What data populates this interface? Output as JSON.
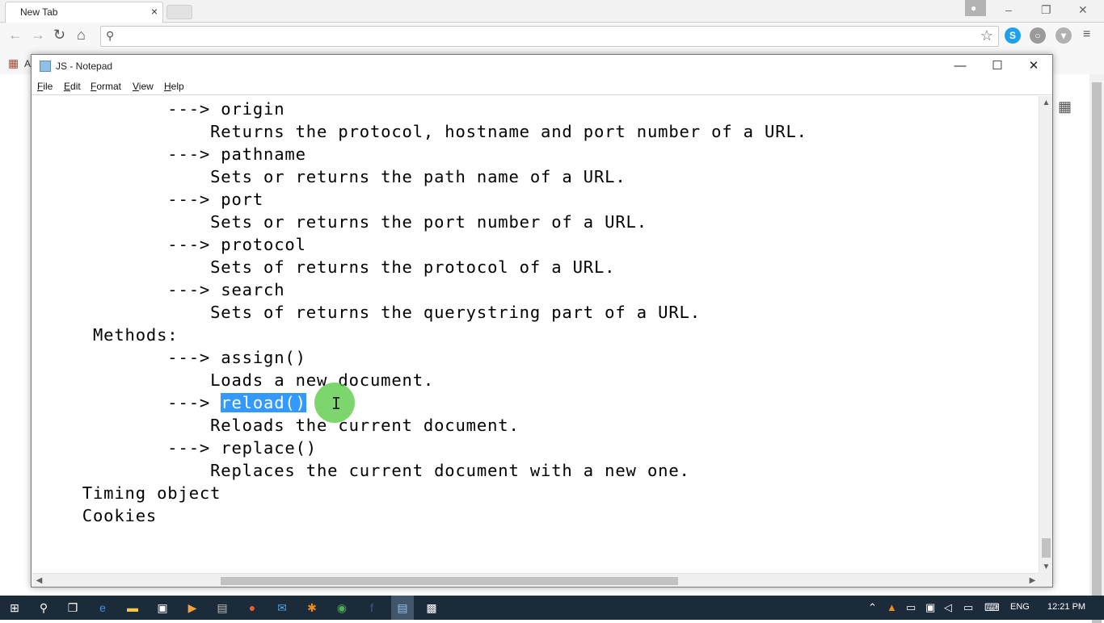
{
  "browser": {
    "tab_title": "New Tab",
    "tab_close": "×",
    "bookmarks_apps_label": "A",
    "window_controls": {
      "minimize": "–",
      "restore": "❐",
      "close": "✕"
    }
  },
  "notepad": {
    "title": "JS - Notepad",
    "menu": [
      {
        "label": "File",
        "accel": "F",
        "rest": "ile"
      },
      {
        "label": "Edit",
        "accel": "E",
        "rest": "dit"
      },
      {
        "label": "Format",
        "accel": "F",
        "rest": "ormat"
      },
      {
        "label": "View",
        "accel": "V",
        "rest": "iew"
      },
      {
        "label": "Help",
        "accel": "H",
        "rest": "elp"
      }
    ],
    "controls": {
      "minimize": "—",
      "maximize": "☐",
      "close": "✕"
    },
    "lines": [
      "            ---> origin",
      "                Returns the protocol, hostname and port number of a URL.",
      "            ---> pathname",
      "                Sets or returns the path name of a URL.",
      "            ---> port",
      "                Sets or returns the port number of a URL.",
      "            ---> protocol",
      "                Sets of returns the protocol of a URL.",
      "            ---> search",
      "                Sets of returns the querystring part of a URL.",
      "     Methods:",
      "            ---> assign()",
      "                Loads a new document.",
      "            ---> ",
      "                Reloads the current document.",
      "            ---> replace()",
      "                Replaces the current document with a new one.",
      "    Timing object",
      "    Cookies"
    ],
    "selected_text": "reload()",
    "selected_line_index": 13
  },
  "taskbar": {
    "language": "ENG",
    "clock": "12:21 PM"
  }
}
